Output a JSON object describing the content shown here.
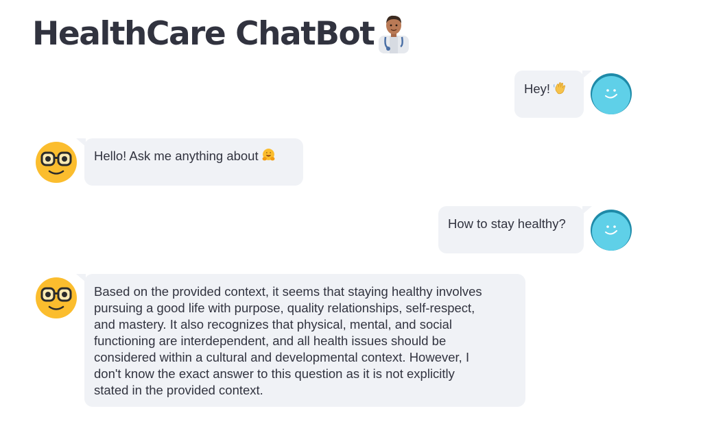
{
  "header": {
    "title": "HealthCare ChatBot",
    "title_icon": "doctor-emoji-icon"
  },
  "colors": {
    "text": "#31333f",
    "bubble_bg": "#f0f2f6",
    "user_avatar": "#5fd0e8",
    "user_avatar_shadow": "#1e8aa8",
    "bot_avatar": "#fbbd2e"
  },
  "messages": [
    {
      "role": "user",
      "text": "Hey!",
      "emoji": "waving-hand-icon",
      "avatar": "smiley-blue-avatar"
    },
    {
      "role": "bot",
      "text": "Hello! Ask me anything about",
      "emoji": "hugging-face-icon",
      "avatar": "nerd-face-avatar"
    },
    {
      "role": "user",
      "text": "How to stay healthy?",
      "avatar": "smiley-blue-avatar"
    },
    {
      "role": "bot",
      "lines": [
        "Based on the provided context, it seems that staying healthy involves",
        "pursuing a good life with purpose, quality relationships, self-respect,",
        "and mastery. It also recognizes that physical, mental, and social",
        "functioning are interdependent, and all health issues should be",
        "considered within a cultural and developmental context. However, I",
        "don't know the exact answer to this question as it is not explicitly",
        "stated in the provided context."
      ],
      "avatar": "nerd-face-avatar"
    }
  ]
}
